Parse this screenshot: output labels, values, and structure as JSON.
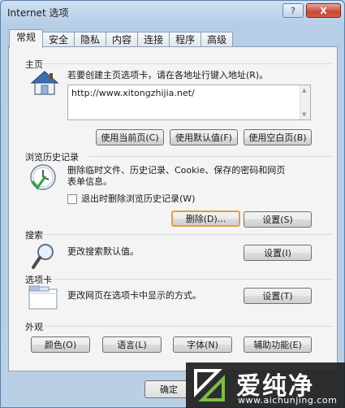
{
  "window": {
    "title": "Internet 选项",
    "help": "?",
    "close": "X"
  },
  "tabs": [
    "常规",
    "安全",
    "隐私",
    "内容",
    "连接",
    "程序",
    "高级"
  ],
  "homepage": {
    "title": "主页",
    "desc": "若要创建主页选项卡，请在各地址行键入地址(R)。",
    "url": "http://www.xitongzhijia.net/",
    "buttons": [
      "使用当前页(C)",
      "使用默认值(F)",
      "使用空白页(B)"
    ]
  },
  "history": {
    "title": "浏览历史记录",
    "desc1": "删除临时文件、历史记录、Cookie、保存的密码和网页",
    "desc2": "表单信息。",
    "checkbox": "退出时删除浏览历史记录(W)",
    "delete": "删除(D)...",
    "settings": "设置(S)"
  },
  "search": {
    "title": "搜索",
    "desc": "更改搜索默认值。",
    "settings": "设置(I)"
  },
  "tabsgroup": {
    "title": "选项卡",
    "desc": "更改网页在选项卡中显示的方式。",
    "settings": "设置(T)"
  },
  "appearance": {
    "title": "外观",
    "buttons": [
      "颜色(O)",
      "语言(L)",
      "字体(N)",
      "辅助功能(E)"
    ]
  },
  "footer": {
    "ok": "确定"
  },
  "watermark": {
    "text": "爱纯净",
    "url": "www.aichunjing.com"
  },
  "colors": {
    "focus": "#e69a48",
    "close": "#c64a34"
  }
}
